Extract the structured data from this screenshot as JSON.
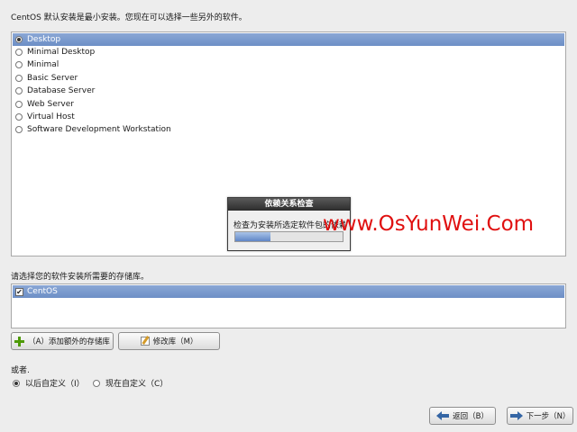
{
  "intro_text": "CentOS 默认安装是最小安装。您现在可以选择一些另外的软件。",
  "groups": [
    {
      "label": "Desktop",
      "selected": true
    },
    {
      "label": "Minimal Desktop",
      "selected": false
    },
    {
      "label": "Minimal",
      "selected": false
    },
    {
      "label": "Basic Server",
      "selected": false
    },
    {
      "label": "Database Server",
      "selected": false
    },
    {
      "label": "Web Server",
      "selected": false
    },
    {
      "label": "Virtual Host",
      "selected": false
    },
    {
      "label": "Software Development Workstation",
      "selected": false
    }
  ],
  "repo_prompt": "请选择您的软件安装所需要的存储库。",
  "repos": [
    {
      "label": "CentOS",
      "checked": true,
      "check_mark": "✔"
    }
  ],
  "buttons": {
    "add_repo": "（A）添加额外的存储库",
    "modify_repo": "修改库（M）",
    "back": "返回（B）",
    "next": "下一步（N）"
  },
  "customize": {
    "or_label": "或者.",
    "later": "以后自定义（I）",
    "now": "现在自定义（C）",
    "selected": "later"
  },
  "dialog": {
    "title": "依赖关系检查",
    "message": "检查为安装所选定软件包的依赖",
    "progress": 0.33
  },
  "watermark": "www.OsYunWei.Com",
  "colors": {
    "selection": "#7896cc",
    "watermark": "#e01010"
  }
}
